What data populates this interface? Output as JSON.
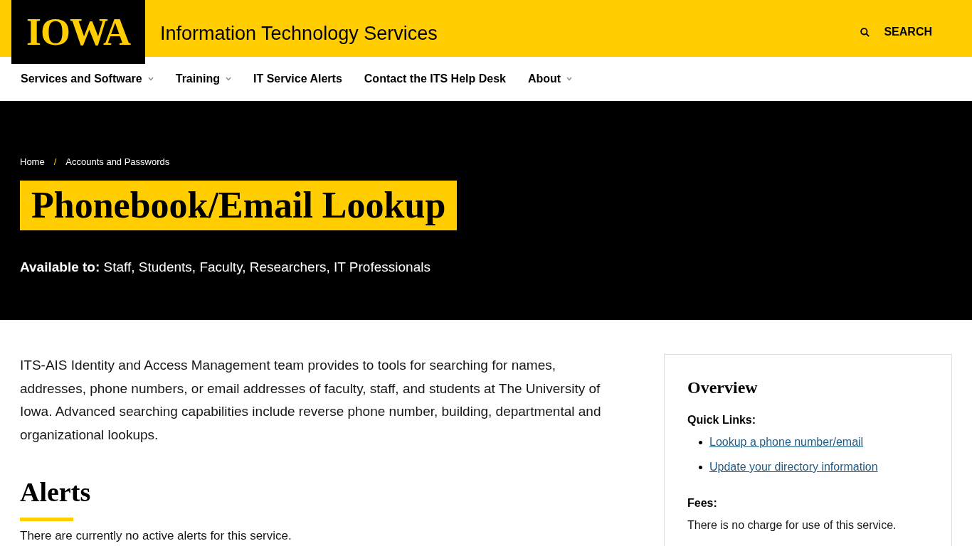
{
  "header": {
    "logo": "IOWA",
    "site_title": "Information Technology Services",
    "search": {
      "label": "SEARCH"
    }
  },
  "nav": {
    "items": [
      {
        "label": "Services and Software",
        "has_dropdown": true
      },
      {
        "label": "Training",
        "has_dropdown": true
      },
      {
        "label": "IT Service Alerts",
        "has_dropdown": false
      },
      {
        "label": "Contact the ITS Help Desk",
        "has_dropdown": false
      },
      {
        "label": "About",
        "has_dropdown": true
      }
    ]
  },
  "hero": {
    "breadcrumb": [
      {
        "label": "Home"
      },
      {
        "label": "Accounts and Passwords"
      }
    ],
    "separator": "/",
    "title": "Phonebook/Email Lookup",
    "availability": "**Available to:** Staff, Students, Faculty, Researchers, IT Professionals"
  },
  "content": {
    "intro": "ITS-AIS Identity and Access Management team provides to tools for searching for names, addresses, phone numbers, or email addresses of faculty, staff, and students at The University of Iowa. Advanced searching capabilities include reverse phone number, building, departmental and organizational lookups.",
    "alerts": {
      "heading": "Alerts",
      "text": "There are currently no active alerts for this service."
    }
  },
  "sidebar": {
    "heading": "Overview",
    "sections": [
      {
        "kind": "links",
        "heading": "Quick Links:",
        "links": [
          {
            "label": "Lookup a phone number/email"
          },
          {
            "label": "Update your directory information"
          }
        ]
      },
      {
        "kind": "text",
        "heading": "Fees:",
        "text": "There is no charge for use of this service."
      }
    ]
  }
}
